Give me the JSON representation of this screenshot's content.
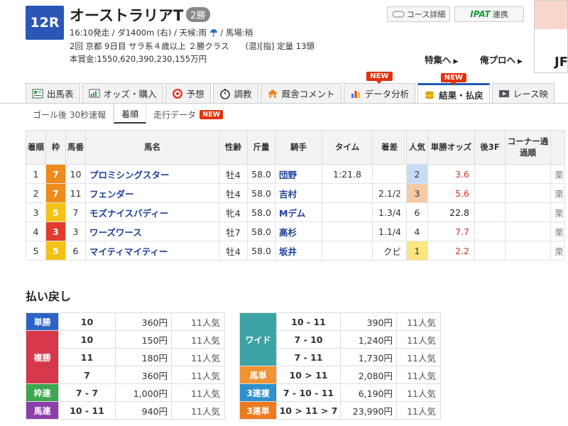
{
  "race": {
    "number": "12R",
    "name": "オーストラリアT",
    "grade": "2勝",
    "info1_prefix": "16:10発走 / ダ1400m (右) / 天候:雨",
    "info1_suffix": " / 馬場:稍",
    "info2": "2回 京都 9日目 サラ系４歳以上 ２勝クラス　　(混)[指] 定量 13頭",
    "prize": "本賞金:1550,620,390,230,155万円"
  },
  "header_links": {
    "course": "コース詳細",
    "ipat_logo": "IPAT",
    "ipat_label": "連携",
    "tokushu": "特集へ",
    "pro": "俺プロへ",
    "ad_text": "JF"
  },
  "tabs": [
    {
      "label": "出馬表",
      "icon": "race-card-icon",
      "new": false
    },
    {
      "label": "オッズ・購入",
      "icon": "odds-icon",
      "new": false
    },
    {
      "label": "予想",
      "icon": "target-icon",
      "new": false
    },
    {
      "label": "調教",
      "icon": "stopwatch-icon",
      "new": false
    },
    {
      "label": "厩舎コメント",
      "icon": "stable-icon",
      "new": false
    },
    {
      "label": "データ分析",
      "icon": "data-chart-icon",
      "new": true
    },
    {
      "label": "結果・払戻",
      "icon": "coins-icon",
      "new": true
    },
    {
      "label": "レース映",
      "icon": "video-icon",
      "new": false
    }
  ],
  "new_label": "NEW",
  "subtabs": [
    "ゴール後 30秒速報",
    "着順",
    "走行データ"
  ],
  "results_headers": {
    "rank": "着順",
    "frame": "枠",
    "num": "馬番",
    "name": "馬名",
    "sexage": "性齢",
    "weight": "斤量",
    "jockey": "騎手",
    "time": "タイム",
    "margin": "着差",
    "pop": "人気",
    "odds": "単勝オッズ",
    "last3f": "後3F",
    "corner": "コーナー通過順"
  },
  "results_partial_col": "栗",
  "results": [
    {
      "rank": "1",
      "frame": "7",
      "frame_color": "#ef8a1c",
      "num": "10",
      "name": "プロミシングスター",
      "sexage": "牡4",
      "weight": "58.0",
      "jockey": "団野",
      "time": "1:21.8",
      "margin": "",
      "pop": "2",
      "odds": "3.6"
    },
    {
      "rank": "2",
      "frame": "7",
      "frame_color": "#ef8a1c",
      "num": "11",
      "name": "フェンダー",
      "sexage": "牡4",
      "weight": "58.0",
      "jockey": "吉村",
      "time": "",
      "margin": "2.1/2",
      "pop": "3",
      "odds": "5.6"
    },
    {
      "rank": "3",
      "frame": "5",
      "frame_color": "#f4c215",
      "num": "7",
      "name": "モズナイスバディー",
      "sexage": "牝4",
      "weight": "58.0",
      "jockey": "Mデム",
      "time": "",
      "margin": "1.3/4",
      "pop": "6",
      "odds": "22.8"
    },
    {
      "rank": "4",
      "frame": "3",
      "frame_color": "#e23a2c",
      "num": "3",
      "name": "ワーズワース",
      "sexage": "牡7",
      "weight": "58.0",
      "jockey": "高杉",
      "time": "",
      "margin": "1.1/4",
      "pop": "4",
      "odds": "7.7"
    },
    {
      "rank": "5",
      "frame": "5",
      "frame_color": "#f4c215",
      "num": "6",
      "name": "マイティマイティー",
      "sexage": "牡4",
      "weight": "58.0",
      "jockey": "坂井",
      "time": "",
      "margin": "クビ",
      "pop": "1",
      "odds": "2.2"
    }
  ],
  "payout_title": "払い戻し",
  "payout_left": [
    {
      "label": "単勝",
      "color": "#2c63c4",
      "rows": [
        {
          "combo": "10",
          "amount": "360円",
          "pop": "11人気"
        }
      ]
    },
    {
      "label": "複勝",
      "color": "#d5384a",
      "rows": [
        {
          "combo": "10",
          "amount": "150円",
          "pop": "11人気"
        },
        {
          "combo": "11",
          "amount": "180円",
          "pop": "11人気"
        },
        {
          "combo": "7",
          "amount": "360円",
          "pop": "11人気"
        }
      ]
    },
    {
      "label": "枠連",
      "color": "#3ea550",
      "rows": [
        {
          "combo": "7 - 7",
          "amount": "1,000円",
          "pop": "11人気"
        }
      ]
    },
    {
      "label": "馬連",
      "color": "#8b3fa8",
      "rows": [
        {
          "combo": "10 - 11",
          "amount": "940円",
          "pop": "11人気"
        }
      ]
    }
  ],
  "payout_right": [
    {
      "label": "ワイド",
      "color": "#3da3a4",
      "rows": [
        {
          "combo": "10 - 11",
          "amount": "390円",
          "pop": "11人気"
        },
        {
          "combo": "7 - 10",
          "amount": "1,240円",
          "pop": "11人気"
        },
        {
          "combo": "7 - 11",
          "amount": "1,730円",
          "pop": "11人気"
        }
      ]
    },
    {
      "label": "馬単",
      "color": "#f09434",
      "rows": [
        {
          "combo": "10 > 11",
          "amount": "2,080円",
          "pop": "11人気"
        }
      ]
    },
    {
      "label": "3連複",
      "color": "#2f8fcf",
      "rows": [
        {
          "combo": "7 - 10 - 11",
          "amount": "6,190円",
          "pop": "11人気"
        }
      ]
    },
    {
      "label": "3連単",
      "color": "#ec7a1e",
      "rows": [
        {
          "combo": "10 > 11 > 7",
          "amount": "23,990円",
          "pop": "11人気"
        }
      ]
    }
  ]
}
